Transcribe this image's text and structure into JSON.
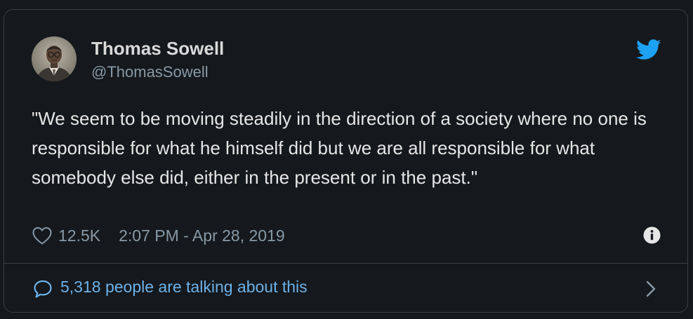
{
  "tweet": {
    "author_name": "Thomas Sowell",
    "author_handle": "@ThomasSowell",
    "text": "\"We seem to be moving steadily in the direction of a society where no one is responsible for what he himself did but we are all responsible for what somebody else did, either in the present or in the past.\"",
    "likes": "12.5K",
    "timestamp": "2:07 PM - Apr 28, 2019",
    "talking_text": "5,318 people are talking about this"
  },
  "icons": {
    "brand": "twitter-bird-icon",
    "like": "heart-icon",
    "info": "info-icon",
    "comments": "speech-bubble-icon",
    "more": "chevron-right-icon"
  },
  "colors": {
    "background": "#15181c",
    "border": "#3a3f44",
    "text": "#e6e6e6",
    "muted": "#8899a6",
    "link": "#6cb2ea",
    "twitter_blue": "#1da1f2"
  }
}
